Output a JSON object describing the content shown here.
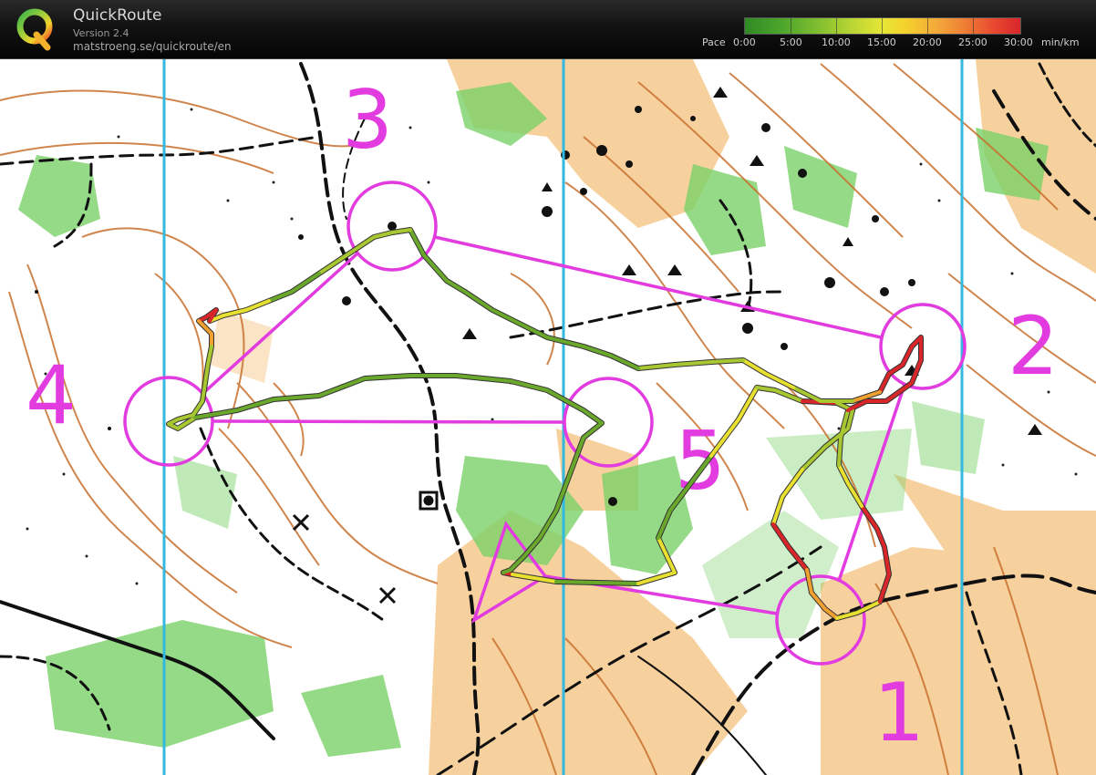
{
  "app": {
    "name": "QuickRoute",
    "version": "Version 2.4",
    "url": "matstroeng.se/quickroute/en",
    "logo_letter": "Q"
  },
  "pace_legend": {
    "label": "Pace",
    "ticks": [
      "0:00",
      "5:00",
      "10:00",
      "15:00",
      "20:00",
      "25:00",
      "30:00"
    ],
    "unit": "min/km",
    "colors": [
      "#2f8a24",
      "#7ebd2f",
      "#e6e636",
      "#f3a83a",
      "#d9262b"
    ]
  },
  "map": {
    "course_color": "#e23be0",
    "control_numbers": [
      "1",
      "2",
      "3",
      "4",
      "5"
    ],
    "route_colors": {
      "fast": "#3f8f22",
      "medium": "#a8c832",
      "slow": "#e8e030",
      "slower": "#f0a030",
      "slowest": "#d8262a"
    }
  }
}
